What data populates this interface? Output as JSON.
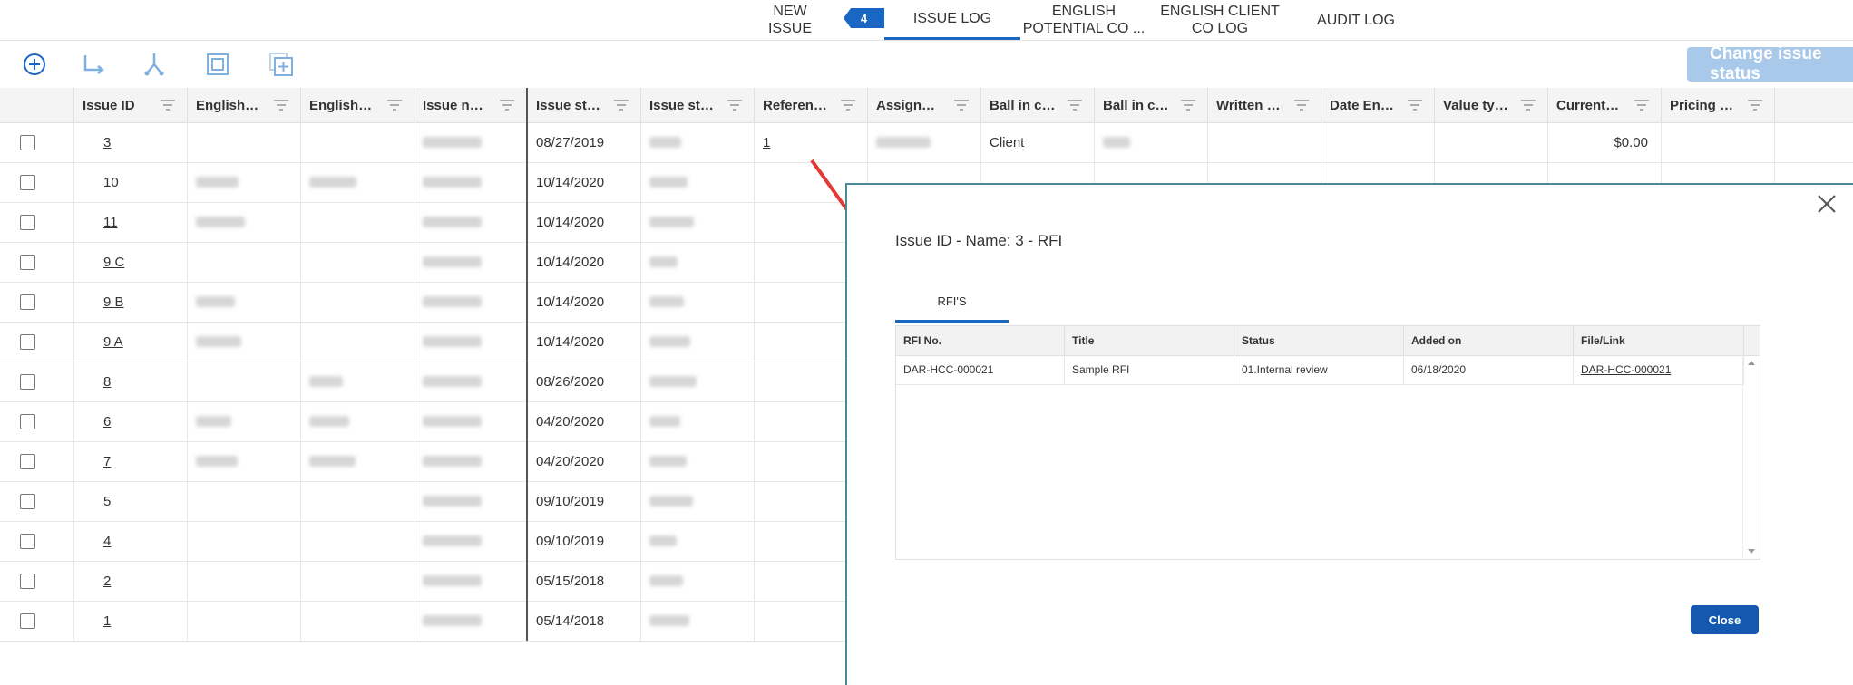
{
  "nav": {
    "tabs": [
      {
        "label": "NEW\nISSUE"
      },
      {
        "label": "ISSUE LOG"
      },
      {
        "label": "ENGLISH\nPOTENTIAL CO ..."
      },
      {
        "label": "ENGLISH CLIENT\nCO LOG"
      },
      {
        "label": "AUDIT LOG"
      }
    ],
    "badge": "4"
  },
  "toolbar": {
    "icons": [
      "add-icon",
      "split-arrow-icon",
      "merge-icon",
      "duplicate-frame-icon",
      "add-copy-icon"
    ],
    "change_status_label": "Change issue status"
  },
  "grid": {
    "columns": [
      "Issue ID",
      "English P...",
      "English Cl...",
      "Issue name",
      "Issue start date",
      "Issue stat...",
      "Reference...",
      "Assigned to",
      "Ball in court",
      "Ball in co...",
      "Written no...",
      "Date Engli...",
      "Value type",
      "Current value",
      "Pricing st..."
    ],
    "rows": [
      {
        "id": "3",
        "date": "08/27/2019",
        "ref": "1",
        "ball": "Client",
        "value": "$0.00"
      },
      {
        "id": "10",
        "date": "10/14/2020",
        "ref": "",
        "ball": "",
        "value": ""
      },
      {
        "id": "11",
        "date": "10/14/2020",
        "ref": "",
        "ball": "",
        "value": ""
      },
      {
        "id": "9 C",
        "date": "10/14/2020",
        "ref": "",
        "ball": "",
        "value": ""
      },
      {
        "id": "9 B",
        "date": "10/14/2020",
        "ref": "",
        "ball": "",
        "value": ""
      },
      {
        "id": "9 A",
        "date": "10/14/2020",
        "ref": "",
        "ball": "",
        "value": ""
      },
      {
        "id": "8",
        "date": "08/26/2020",
        "ref": "",
        "ball": "",
        "value": ""
      },
      {
        "id": "6",
        "date": "04/20/2020",
        "ref": "",
        "ball": "",
        "value": ""
      },
      {
        "id": "7",
        "date": "04/20/2020",
        "ref": "",
        "ball": "",
        "value": ""
      },
      {
        "id": "5",
        "date": "09/10/2019",
        "ref": "",
        "ball": "",
        "value": ""
      },
      {
        "id": "4",
        "date": "09/10/2019",
        "ref": "",
        "ball": "",
        "value": ""
      },
      {
        "id": "2",
        "date": "05/15/2018",
        "ref": "",
        "ball": "",
        "value": ""
      },
      {
        "id": "1",
        "date": "05/14/2018",
        "ref": "",
        "ball": "",
        "value": ""
      }
    ]
  },
  "modal": {
    "title": "Issue ID - Name: 3 - RFI",
    "tab_label": "RFI'S",
    "columns": [
      "RFI No.",
      "Title",
      "Status",
      "Added on",
      "File/Link"
    ],
    "rows": [
      {
        "rfi_no": "DAR-HCC-000021",
        "title": "Sample RFI",
        "status": "01.Internal review",
        "added_on": "06/18/2020",
        "file_link": "DAR-HCC-000021"
      }
    ],
    "close_label": "Close"
  },
  "colors": {
    "accent": "#1a66c4",
    "button_disabled": "#a9c9ea",
    "modal_border": "#4a8a96",
    "arrow": "#e53935"
  }
}
